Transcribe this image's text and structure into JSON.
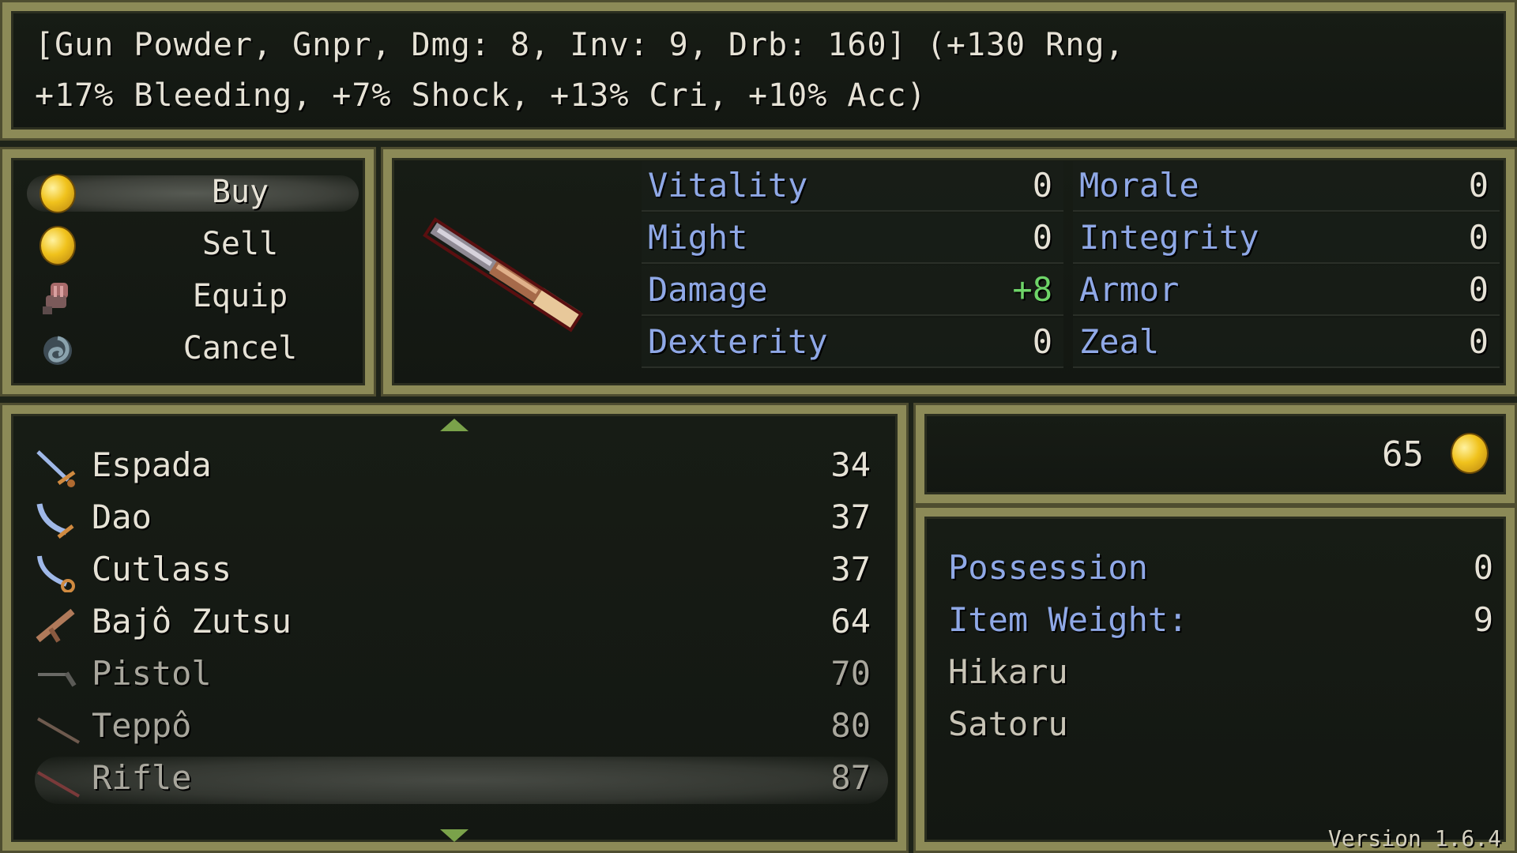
{
  "help": {
    "line1": "[Gun Powder, Gnpr, Dmg: 8, Inv: 9, Drb: 160] (+130 Rng,",
    "line2": "+17% Bleeding, +7% Shock, +13% Cri, +10% Acc)"
  },
  "commands": [
    {
      "label": "Buy",
      "icon": "gold-coin-icon"
    },
    {
      "label": "Sell",
      "icon": "gold-coin-icon"
    },
    {
      "label": "Equip",
      "icon": "gauntlet-icon"
    },
    {
      "label": "Cancel",
      "icon": "swirl-icon"
    }
  ],
  "status": {
    "left": [
      {
        "name": "Vitality",
        "value": "0"
      },
      {
        "name": "Might",
        "value": "0"
      },
      {
        "name": "Damage",
        "value": "+8"
      },
      {
        "name": "Dexterity",
        "value": "0"
      }
    ],
    "right": [
      {
        "name": "Morale",
        "value": "0"
      },
      {
        "name": "Integrity",
        "value": "0"
      },
      {
        "name": "Armor",
        "value": "0"
      },
      {
        "name": "Zeal",
        "value": "0"
      }
    ],
    "colors": {
      "stat_label": "#8fa8e6",
      "positive": "#6ed468"
    }
  },
  "items": [
    {
      "name": "Espada",
      "price": "34",
      "icon": "sword-icon"
    },
    {
      "name": "Dao",
      "price": "37",
      "icon": "sword-icon"
    },
    {
      "name": "Cutlass",
      "price": "37",
      "icon": "sword-icon"
    },
    {
      "name": "Bajô Zutsu",
      "price": "64",
      "icon": "handgun-icon"
    },
    {
      "name": "Pistol",
      "price": "70",
      "icon": "pistol-icon"
    },
    {
      "name": "Teppô",
      "price": "80",
      "icon": "rifle-icon"
    },
    {
      "name": "Rifle",
      "price": "87",
      "icon": "rifle-icon"
    }
  ],
  "gold": {
    "amount": "65"
  },
  "info": {
    "possession_label": "Possession",
    "possession_value": "0",
    "weight_label": "Item Weight:",
    "weight_value": "9",
    "members": [
      "Hikaru",
      "Satoru"
    ]
  },
  "version": "Version 1.6.4"
}
